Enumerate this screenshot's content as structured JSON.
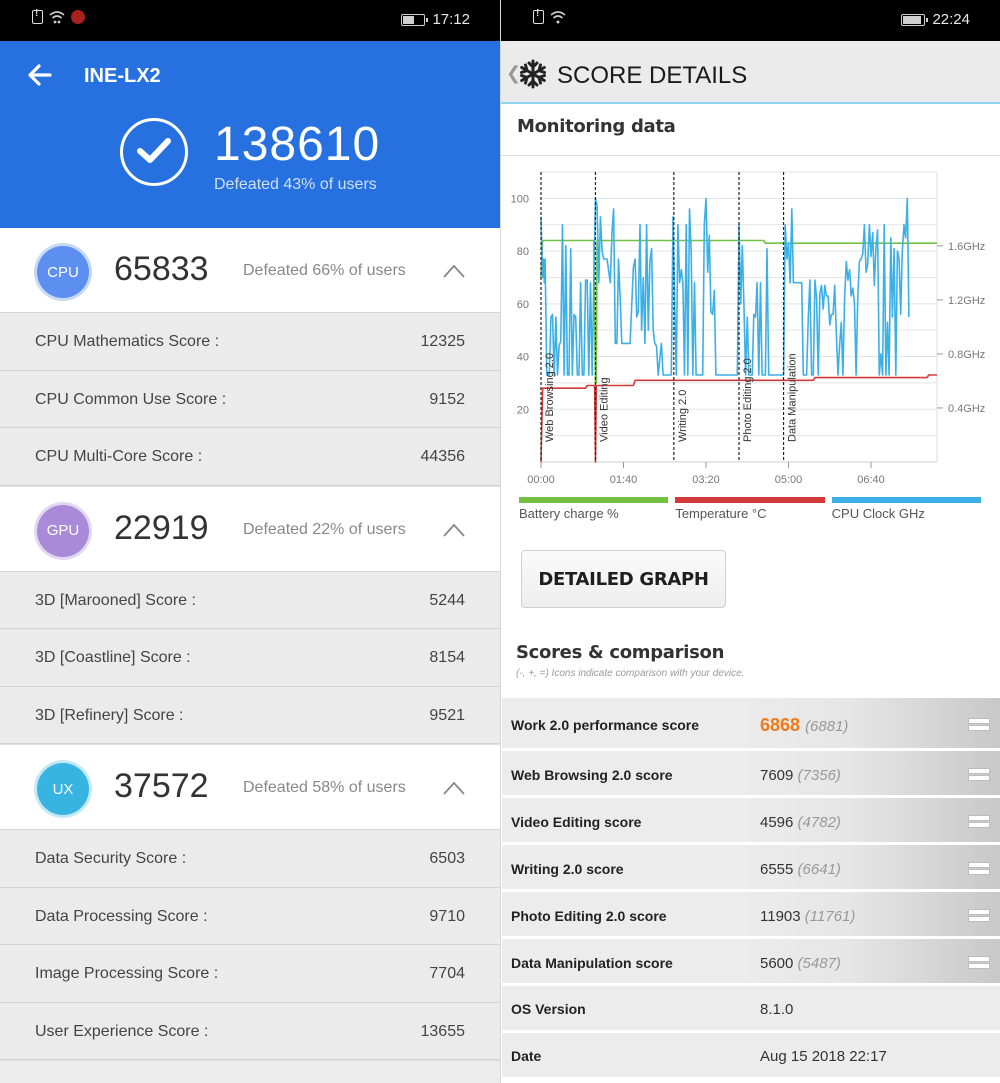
{
  "left": {
    "status": {
      "time": "17:12",
      "icons": [
        "sim-alert-icon",
        "wifi-icon",
        "antutu-app-icon",
        "battery-icon"
      ],
      "battery_level": 0.55
    },
    "header": {
      "back_icon": "arrow-left-icon",
      "device": "INE-LX2",
      "total_score": "138610",
      "defeated": "Defeated 43% of users",
      "check_icon": "check-circle-icon"
    },
    "sections": [
      {
        "badge": "CPU",
        "score": "65833",
        "defeated": "Defeated 66% of users",
        "color": "#5c8ff0",
        "items": [
          {
            "label": "CPU Mathematics Score :",
            "value": "12325"
          },
          {
            "label": "CPU Common Use Score :",
            "value": "9152"
          },
          {
            "label": "CPU Multi-Core Score :",
            "value": "44356"
          }
        ]
      },
      {
        "badge": "GPU",
        "score": "22919",
        "defeated": "Defeated 22% of users",
        "color": "#a88ad8",
        "items": [
          {
            "label": "3D [Marooned] Score :",
            "value": "5244"
          },
          {
            "label": "3D [Coastline] Score :",
            "value": "8154"
          },
          {
            "label": "3D [Refinery] Score :",
            "value": "9521"
          }
        ]
      },
      {
        "badge": "UX",
        "score": "37572",
        "defeated": "Defeated 58% of users",
        "color": "#38b4e2",
        "items": [
          {
            "label": "Data Security Score :",
            "value": "6503"
          },
          {
            "label": "Data Processing Score :",
            "value": "9710"
          },
          {
            "label": "Image Processing Score :",
            "value": "7704"
          },
          {
            "label": "User Experience Score :",
            "value": "13655"
          }
        ]
      }
    ]
  },
  "right": {
    "status": {
      "time": "22:24",
      "icons": [
        "sim-alert-icon",
        "wifi-icon",
        "battery-icon"
      ],
      "battery_level": 0.9
    },
    "topbar": {
      "back_icon": "chevron-left-icon",
      "app_icon": "snowflake-icon",
      "title": "SCORE DETAILS"
    },
    "monitoring_title": "Monitoring data",
    "detailed_graph_button": "DETAILED GRAPH",
    "scores_title": "Scores & comparison",
    "scores_subtitle": "(-, +, =) Icons indicate comparison with your device.",
    "scores": [
      {
        "name": "Work 2.0 performance score",
        "value": "6868",
        "compare": "(6881)",
        "indicator": "equal-icon",
        "primary": true
      },
      {
        "name": "Web Browsing 2.0 score",
        "value": "7609",
        "compare": "(7356)",
        "indicator": "equal-icon"
      },
      {
        "name": "Video Editing score",
        "value": "4596",
        "compare": "(4782)",
        "indicator": "equal-icon"
      },
      {
        "name": "Writing 2.0 score",
        "value": "6555",
        "compare": "(6641)",
        "indicator": "equal-icon"
      },
      {
        "name": "Photo Editing 2.0 score",
        "value": "11903",
        "compare": "(11761)",
        "indicator": "equal-icon"
      },
      {
        "name": "Data Manipulation score",
        "value": "5600",
        "compare": "(5487)",
        "indicator": "equal-icon"
      }
    ],
    "info": [
      {
        "name": "OS Version",
        "value": "8.1.0"
      },
      {
        "name": "Date",
        "value": "Aug 15 2018 22:17"
      }
    ]
  },
  "chart_data": {
    "type": "line",
    "title": "Monitoring data",
    "x_unit": "mm:ss",
    "xlim_seconds": [
      0,
      480
    ],
    "x_ticks": [
      {
        "t": 0,
        "label": "00:00"
      },
      {
        "t": 100,
        "label": "01:40"
      },
      {
        "t": 200,
        "label": "03:20"
      },
      {
        "t": 300,
        "label": "05:00"
      },
      {
        "t": 400,
        "label": "06:40"
      }
    ],
    "y_left": {
      "ticks": [
        20,
        40,
        60,
        80,
        100
      ],
      "ylim": [
        0,
        110
      ]
    },
    "y_right": {
      "ticks": [
        "0.4GHz",
        "0.8GHz",
        "1.2GHz",
        "1.6GHz"
      ],
      "tick_values_on_left_scale": [
        20.5,
        41,
        61.5,
        82
      ]
    },
    "grid": true,
    "markers": [
      {
        "t": 0,
        "label": "Web Browsing 2.0"
      },
      {
        "t": 66,
        "label": "Video Editing"
      },
      {
        "t": 161,
        "label": "Writing 2.0"
      },
      {
        "t": 240,
        "label": "Photo Editing 2.0"
      },
      {
        "t": 294,
        "label": "Data Manipulation"
      }
    ],
    "legend": [
      {
        "name": "Battery charge %",
        "color": "#74c043"
      },
      {
        "name": "Temperature °C",
        "color": "#d23a3a"
      },
      {
        "name": "CPU Clock GHz",
        "color": "#3cb0e6"
      }
    ],
    "legend_position": "bottom",
    "series": [
      {
        "name": "Battery charge %",
        "color": "#74c043",
        "points": [
          [
            0,
            70
          ],
          [
            2,
            84
          ],
          [
            64,
            84
          ],
          [
            66,
            30
          ],
          [
            67,
            30
          ],
          [
            68,
            84
          ],
          [
            108,
            84
          ],
          [
            230,
            84
          ],
          [
            240,
            84
          ],
          [
            270,
            84
          ],
          [
            272,
            83
          ],
          [
            480,
            83
          ]
        ]
      },
      {
        "name": "Temperature °C",
        "color": "#d23a3a",
        "points": [
          [
            0,
            0
          ],
          [
            2,
            28
          ],
          [
            54,
            28
          ],
          [
            56,
            29
          ],
          [
            65,
            29
          ],
          [
            66,
            0
          ],
          [
            67,
            29
          ],
          [
            112,
            29
          ],
          [
            114,
            31
          ],
          [
            330,
            31
          ],
          [
            332,
            32
          ],
          [
            468,
            32
          ],
          [
            470,
            33
          ],
          [
            480,
            33
          ]
        ]
      },
      {
        "name": "CPU Clock GHz",
        "color": "#3cb0e6",
        "points": [
          [
            0,
            93
          ],
          [
            2,
            70
          ],
          [
            3,
            77
          ],
          [
            4,
            68
          ],
          [
            5,
            77
          ],
          [
            7,
            33
          ],
          [
            10,
            33
          ],
          [
            12,
            55
          ],
          [
            14,
            56
          ],
          [
            16,
            33
          ],
          [
            18,
            55
          ],
          [
            20,
            33
          ],
          [
            22,
            44
          ],
          [
            24,
            46
          ],
          [
            26,
            90
          ],
          [
            28,
            33
          ],
          [
            30,
            82
          ],
          [
            32,
            33
          ],
          [
            34,
            33
          ],
          [
            36,
            81
          ],
          [
            38,
            33
          ],
          [
            40,
            56
          ],
          [
            42,
            55
          ],
          [
            44,
            33
          ],
          [
            46,
            33
          ],
          [
            48,
            68
          ],
          [
            50,
            33
          ],
          [
            52,
            33
          ],
          [
            54,
            69
          ],
          [
            56,
            69
          ],
          [
            58,
            33
          ],
          [
            60,
            68
          ],
          [
            62,
            33
          ],
          [
            64,
            69
          ],
          [
            66,
            100
          ],
          [
            68,
            97
          ],
          [
            70,
            68
          ],
          [
            72,
            93
          ],
          [
            74,
            80
          ],
          [
            76,
            77
          ],
          [
            78,
            77
          ],
          [
            80,
            77
          ],
          [
            84,
            68
          ],
          [
            86,
            87
          ],
          [
            88,
            96
          ],
          [
            90,
            45
          ],
          [
            92,
            45
          ],
          [
            94,
            77
          ],
          [
            96,
            62
          ],
          [
            98,
            45
          ],
          [
            100,
            45
          ],
          [
            104,
            45
          ],
          [
            108,
            45
          ],
          [
            112,
            74
          ],
          [
            114,
            77
          ],
          [
            116,
            55
          ],
          [
            118,
            57
          ],
          [
            120,
            90
          ],
          [
            122,
            50
          ],
          [
            124,
            70
          ],
          [
            126,
            45
          ],
          [
            128,
            90
          ],
          [
            130,
            50
          ],
          [
            132,
            76
          ],
          [
            134,
            81
          ],
          [
            136,
            50
          ],
          [
            138,
            45
          ],
          [
            140,
            44
          ],
          [
            142,
            33
          ],
          [
            146,
            45
          ],
          [
            148,
            33
          ],
          [
            152,
            33
          ],
          [
            158,
            33
          ],
          [
            160,
            93
          ],
          [
            162,
            60
          ],
          [
            164,
            33
          ],
          [
            166,
            90
          ],
          [
            168,
            68
          ],
          [
            170,
            73
          ],
          [
            172,
            68
          ],
          [
            174,
            33
          ],
          [
            176,
            90
          ],
          [
            178,
            33
          ],
          [
            180,
            96
          ],
          [
            182,
            80
          ],
          [
            184,
            33
          ],
          [
            186,
            68
          ],
          [
            188,
            33
          ],
          [
            192,
            33
          ],
          [
            196,
            33
          ],
          [
            198,
            90
          ],
          [
            200,
            100
          ],
          [
            202,
            72
          ],
          [
            204,
            86
          ],
          [
            206,
            57
          ],
          [
            208,
            56
          ],
          [
            210,
            65
          ],
          [
            212,
            33
          ],
          [
            222,
            33
          ],
          [
            238,
            33
          ],
          [
            240,
            90
          ],
          [
            242,
            60
          ],
          [
            244,
            82
          ],
          [
            246,
            60
          ],
          [
            248,
            33
          ],
          [
            250,
            55
          ],
          [
            252,
            33
          ],
          [
            256,
            33
          ],
          [
            258,
            56
          ],
          [
            260,
            55
          ],
          [
            262,
            68
          ],
          [
            264,
            33
          ],
          [
            266,
            68
          ],
          [
            268,
            33
          ],
          [
            272,
            33
          ],
          [
            274,
            81
          ],
          [
            276,
            33
          ],
          [
            278,
            33
          ],
          [
            280,
            33
          ],
          [
            288,
            33
          ],
          [
            294,
            33
          ],
          [
            296,
            90
          ],
          [
            298,
            77
          ],
          [
            300,
            83
          ],
          [
            302,
            68
          ],
          [
            304,
            96
          ],
          [
            306,
            68
          ],
          [
            310,
            68
          ],
          [
            316,
            68
          ],
          [
            318,
            33
          ],
          [
            322,
            33
          ],
          [
            324,
            55
          ],
          [
            326,
            69
          ],
          [
            328,
            33
          ],
          [
            330,
            33
          ],
          [
            332,
            69
          ],
          [
            334,
            62
          ],
          [
            336,
            33
          ],
          [
            338,
            64
          ],
          [
            340,
            67
          ],
          [
            342,
            58
          ],
          [
            344,
            67
          ],
          [
            346,
            63
          ],
          [
            348,
            63
          ],
          [
            350,
            52
          ],
          [
            352,
            56
          ],
          [
            354,
            56
          ],
          [
            356,
            67
          ],
          [
            358,
            48
          ],
          [
            360,
            33
          ],
          [
            362,
            44
          ],
          [
            364,
            53
          ],
          [
            366,
            33
          ],
          [
            368,
            62
          ],
          [
            370,
            76
          ],
          [
            372,
            69
          ],
          [
            374,
            73
          ],
          [
            376,
            63
          ],
          [
            378,
            66
          ],
          [
            380,
            60
          ],
          [
            382,
            33
          ],
          [
            384,
            63
          ],
          [
            386,
            76
          ],
          [
            388,
            77
          ],
          [
            390,
            79
          ],
          [
            392,
            90
          ],
          [
            394,
            72
          ],
          [
            396,
            75
          ],
          [
            398,
            90
          ],
          [
            400,
            78
          ],
          [
            402,
            87
          ],
          [
            404,
            67
          ],
          [
            406,
            81
          ],
          [
            408,
            88
          ],
          [
            410,
            33
          ],
          [
            412,
            41
          ],
          [
            414,
            33
          ],
          [
            416,
            90
          ],
          [
            418,
            33
          ],
          [
            420,
            53
          ],
          [
            422,
            33
          ],
          [
            424,
            85
          ],
          [
            426,
            55
          ],
          [
            428,
            81
          ],
          [
            430,
            33
          ],
          [
            432,
            80
          ],
          [
            434,
            77
          ],
          [
            436,
            56
          ],
          [
            438,
            80
          ],
          [
            440,
            90
          ],
          [
            442,
            85
          ],
          [
            444,
            100
          ],
          [
            446,
            55
          ]
        ]
      }
    ]
  }
}
